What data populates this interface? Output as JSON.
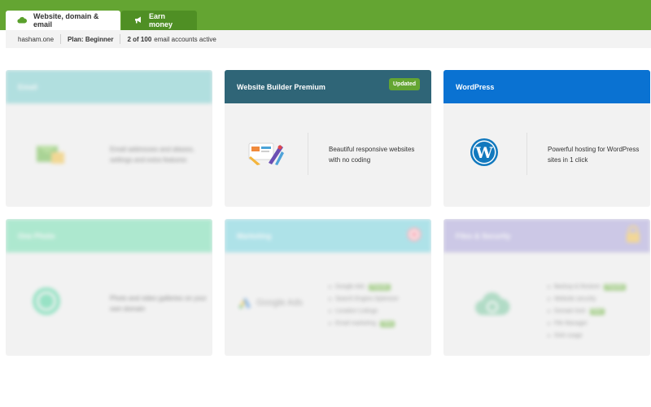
{
  "tabs": [
    {
      "label": "Website, domain & email",
      "active": true,
      "icon": "cloud-icon"
    },
    {
      "label": "Earn money",
      "active": false,
      "icon": "megaphone-icon"
    }
  ],
  "account": {
    "domain": "hasham.one",
    "plan_label": "Plan: Beginner",
    "email_count": "2 of 100",
    "email_text": "email accounts active"
  },
  "cards": {
    "email": {
      "title": "Email",
      "description": "Email addresses and aliases, settings and extra features",
      "icon": "email-envelope-icon",
      "color": "#7ccfd0"
    },
    "builder": {
      "title": "Website Builder Premium",
      "badge": "Updated",
      "description": "Beautiful responsive websites with no coding",
      "icon": "design-tools-icon",
      "color": "#2f6577"
    },
    "wordpress": {
      "title": "WordPress",
      "description": "Powerful hosting for WordPress sites in 1 click",
      "icon": "wordpress-icon",
      "color": "#0a72d2"
    },
    "photo": {
      "title": "One Photo",
      "description": "Photo and video galleries on your own domain",
      "icon": "camera-lens-icon",
      "color": "#76e0b3"
    },
    "marketing": {
      "title": "Marketing",
      "icon": "google-ads-icon",
      "logo_text": "Google Ads",
      "color": "#77d5e1",
      "features": [
        {
          "label": "Google Ads",
          "pill": "Popular"
        },
        {
          "label": "Search Engine Optimizer",
          "pill": ""
        },
        {
          "label": "Location Listings",
          "pill": ""
        },
        {
          "label": "Email marketing",
          "pill": "New"
        }
      ]
    },
    "security": {
      "title": "Files & Security",
      "icon": "cloud-backup-icon",
      "color": "#ada6dc",
      "features": [
        {
          "label": "Backup & Restore",
          "pill": "Popular"
        },
        {
          "label": "Website security",
          "pill": ""
        },
        {
          "label": "Domain lock",
          "pill": "New"
        },
        {
          "label": "File Manager",
          "pill": ""
        },
        {
          "label": "Disk usage",
          "pill": ""
        }
      ]
    }
  }
}
